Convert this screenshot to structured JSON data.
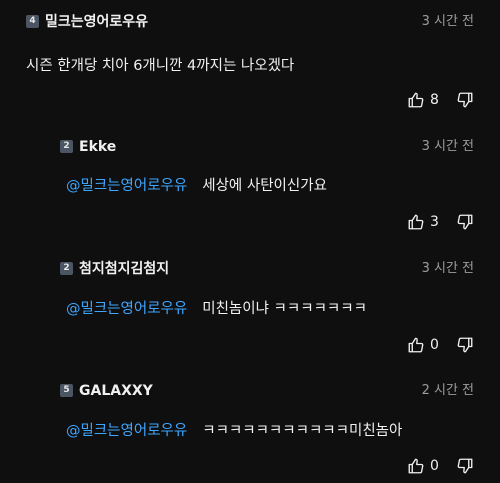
{
  "comments": [
    {
      "author": "밀크는영어로우유",
      "badge": "4",
      "time": "3 시간 전",
      "mention": "",
      "text": "시즌 한개당 치아 6개니깐 4까지는 나오겠다",
      "likes": "8"
    },
    {
      "author": "Ekke",
      "badge": "2",
      "time": "3 시간 전",
      "mention": "@밀크는영어로우유",
      "text": "세상에 사탄이신가요",
      "likes": "3"
    },
    {
      "author": "첨지첨지김첨지",
      "badge": "2",
      "time": "3 시간 전",
      "mention": "@밀크는영어로우유",
      "text": "미친놈이냐 ㅋㅋㅋㅋㅋㅋㅋ",
      "likes": "0"
    },
    {
      "author": "GALAXXY",
      "badge": "5",
      "time": "2 시간 전",
      "mention": "@밀크는영어로우유",
      "text": "ㅋㅋㅋㅋㅋㅋㅋㅋㅋㅋㅋ미친놈아",
      "likes": "0"
    }
  ],
  "colors": {
    "background": "#0f0f0f",
    "text": "#f1f1f1",
    "meta": "#9c9c9c",
    "mention": "#3ea6ff",
    "badge": "#4b5563"
  },
  "icons": {
    "badge": "membership-badge-icon",
    "like": "thumbs-up-icon",
    "dislike": "thumbs-down-icon"
  }
}
